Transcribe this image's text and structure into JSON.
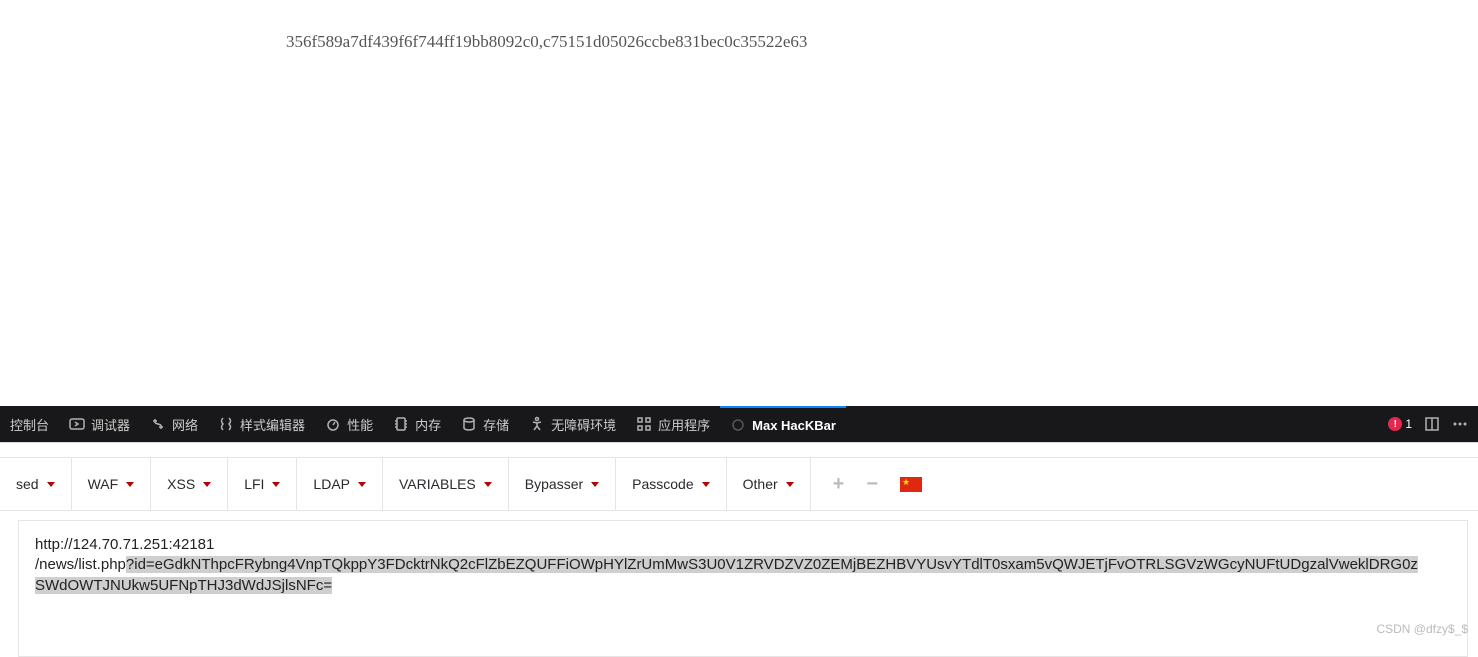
{
  "page": {
    "hash_text": "356f589a7df439f6f744ff19bb8092c0,c75151d05026ccbe831bec0c35522e63"
  },
  "devtools": {
    "tabs": {
      "console": "控制台",
      "debugger": "调试器",
      "network": "网络",
      "style": "样式编辑器",
      "performance": "性能",
      "memory": "内存",
      "storage": "存储",
      "accessibility": "无障碍环境",
      "application": "应用程序",
      "hackbar": "Max HacKBar"
    },
    "error_count": "1"
  },
  "hackbar": {
    "buttons": {
      "sed": "sed",
      "waf": "WAF",
      "xss": "XSS",
      "lfi": "LFI",
      "ldap": "LDAP",
      "variables": "VARIABLES",
      "bypasser": "Bypasser",
      "passcode": "Passcode",
      "other": "Other"
    }
  },
  "url": {
    "line1": "http://124.70.71.251:42181",
    "line2_prefix": "/news/list.php",
    "line2_query": "?id=eGdkNThpcFRybng4VnpTQkppY3FDcktrNkQ2cFlZbEZQUFFiOWpHYlZrUmMwS3U0V1ZRVDZVZ0ZEMjBEZHBVYUsvYTdlT0sxam5vQWJETjFvOTRLSGVzWGcyNUFtUDgzalVweklDRG0z",
    "line3": "SWdOWTJNUkw5UFNpTHJ3dWdJSjlsNFc="
  },
  "watermark": "CSDN @dfzy$_$"
}
